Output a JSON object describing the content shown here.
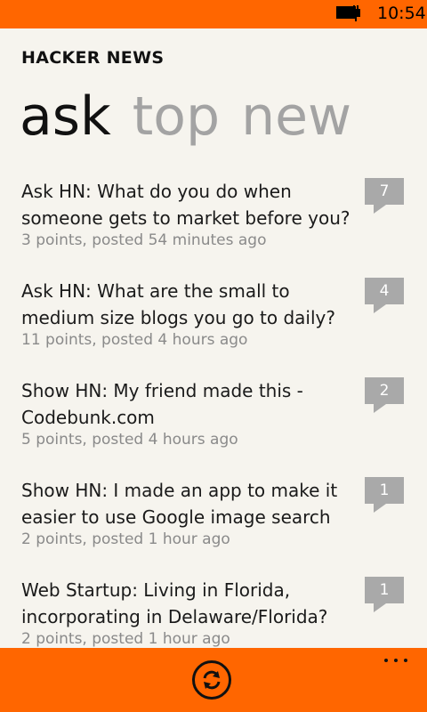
{
  "status": {
    "time": "10:54"
  },
  "header": {
    "app_title": "HACKER NEWS"
  },
  "pivot": {
    "tabs": [
      "ask",
      "top",
      "new"
    ],
    "active_index": 0
  },
  "posts": [
    {
      "title": "Ask HN: What do you do when someone gets to market before you?",
      "meta": "3 points, posted 54 minutes ago",
      "comments": "7"
    },
    {
      "title": "Ask HN: What are the small to medium size blogs you go to daily?",
      "meta": "11 points, posted 4 hours ago",
      "comments": "4"
    },
    {
      "title": "Show HN: My friend made this - Codebunk.com",
      "meta": "5 points, posted 4 hours ago",
      "comments": "2"
    },
    {
      "title": "Show HN: I made an app to make it easier to use Google image search",
      "meta": "2 points, posted 1 hour ago",
      "comments": "1"
    },
    {
      "title": "Web Startup: Living in Florida, incorporating in Delaware/Florida?",
      "meta": "2 points, posted 1 hour ago",
      "comments": "1"
    }
  ],
  "colors": {
    "accent": "#ff6600",
    "background": "#f6f4ee",
    "badge": "#a9a9a9",
    "inactive_tab": "#a3a3a3"
  },
  "icons": {
    "battery": "battery-charging-icon",
    "refresh": "refresh-icon",
    "more": "more-icon"
  }
}
